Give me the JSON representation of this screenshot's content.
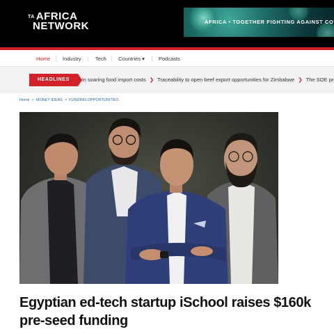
{
  "header": {
    "logo_line1": "AFRICA",
    "logo_line2": "NETWORK",
    "logo_mark": "TA",
    "banner_text": "AFRICA • TOGETHER FIGHTING AGAINST COVID -"
  },
  "nav": {
    "items": [
      {
        "label": "Home"
      },
      {
        "label": "Industry"
      },
      {
        "label": "Tech"
      },
      {
        "label": "Countries ▾"
      },
      {
        "label": "Podcasts"
      }
    ]
  },
  "headlines": {
    "label": "HEADLINES",
    "items": [
      "in soaring food import costs",
      "Traceability to open beef export opportunities for Zimbabwe",
      "The SOE propos"
    ]
  },
  "breadcrumb": [
    "Home",
    "MONEY IDEAS",
    "FUNDING OPPORTUNITIES"
  ],
  "article": {
    "title": "Egyptian ed-tech startup iSchool raises $160k pre-seed funding"
  },
  "colors": {
    "accent": "#d1222c",
    "header_bg": "#000000"
  }
}
